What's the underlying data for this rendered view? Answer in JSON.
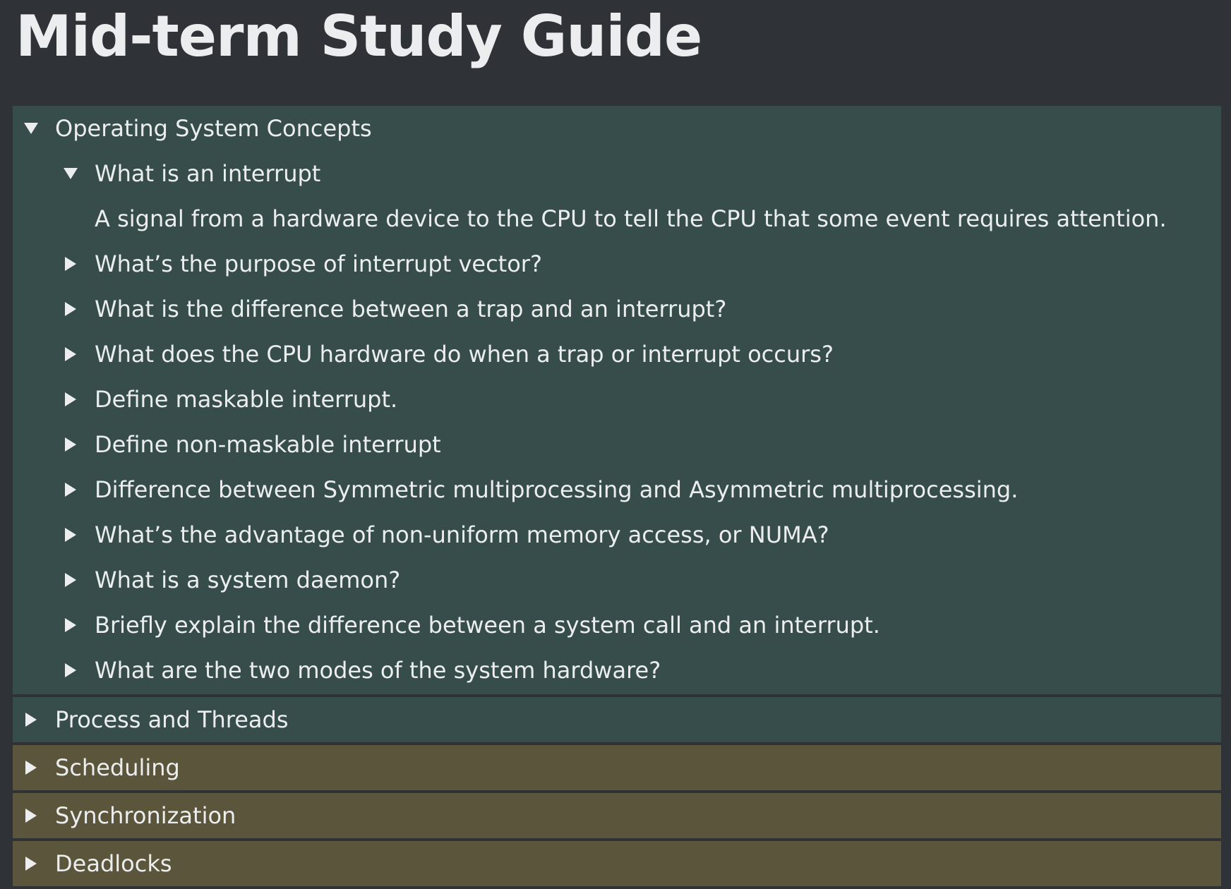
{
  "page": {
    "title": "Mid-term Study Guide"
  },
  "colors": {
    "background": "#2f3337",
    "teal_section": "#364d4c",
    "olive_section": "#5a553b",
    "text": "#ecedee"
  },
  "sections": [
    {
      "label": "Operating System Concepts",
      "expanded": true,
      "color": "teal",
      "items": [
        {
          "label": "What is an interrupt",
          "expanded": true,
          "answer": "A signal from a hardware device to the CPU to tell the CPU that some event requires attention."
        },
        {
          "label": "What’s the purpose of interrupt vector?",
          "expanded": false
        },
        {
          "label": "What is the difference between a trap and an interrupt?",
          "expanded": false
        },
        {
          "label": "What does the CPU hardware do when a trap or interrupt occurs?",
          "expanded": false
        },
        {
          "label": "Define maskable interrupt.",
          "expanded": false
        },
        {
          "label": "Define non-maskable interrupt",
          "expanded": false
        },
        {
          "label": "Difference between Symmetric multiprocessing and Asymmetric multiprocessing.",
          "expanded": false
        },
        {
          "label": "What’s the advantage of non-uniform memory access, or NUMA?",
          "expanded": false
        },
        {
          "label": "What is a system daemon?",
          "expanded": false
        },
        {
          "label": "Briefly explain the difference between a system call and an interrupt.",
          "expanded": false
        },
        {
          "label": "What are the two modes of the system hardware?",
          "expanded": false
        }
      ]
    },
    {
      "label": "Process and Threads",
      "expanded": false,
      "color": "teal"
    },
    {
      "label": "Scheduling",
      "expanded": false,
      "color": "olive"
    },
    {
      "label": "Synchronization",
      "expanded": false,
      "color": "olive"
    },
    {
      "label": "Deadlocks",
      "expanded": false,
      "color": "olive"
    }
  ]
}
